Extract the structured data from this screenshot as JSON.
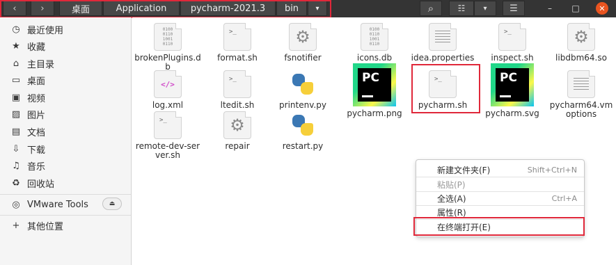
{
  "header": {
    "back_icon": "‹",
    "forward_icon": "›",
    "breadcrumbs": [
      "桌面",
      "Application",
      "pycharm-2021.3",
      "bin"
    ],
    "breadcrumb_menu_icon": "▾",
    "search_icon": "⌕",
    "view_icon": "☷",
    "view_dropdown_icon": "▾",
    "menu_icon": "☰",
    "minimize_icon": "–",
    "maximize_icon": "□",
    "close_icon": "✕"
  },
  "sidebar": {
    "items": [
      {
        "icon": "◷",
        "icon_name": "recent-icon",
        "label": "最近使用"
      },
      {
        "icon": "★",
        "icon_name": "star-icon",
        "label": "收藏"
      },
      {
        "icon": "⌂",
        "icon_name": "home-icon",
        "label": "主目录"
      },
      {
        "icon": "▭",
        "icon_name": "desktop-icon",
        "label": "桌面"
      },
      {
        "icon": "▣",
        "icon_name": "video-icon",
        "label": "视频"
      },
      {
        "icon": "▨",
        "icon_name": "picture-icon",
        "label": "图片"
      },
      {
        "icon": "▤",
        "icon_name": "document-icon",
        "label": "文档"
      },
      {
        "icon": "⇩",
        "icon_name": "download-icon",
        "label": "下载"
      },
      {
        "icon": "♫",
        "icon_name": "music-icon",
        "label": "音乐"
      },
      {
        "icon": "♻",
        "icon_name": "trash-icon",
        "label": "回收站"
      }
    ],
    "device": {
      "icon": "◎",
      "label": "VMware Tools",
      "eject_icon": "⏏"
    },
    "other": {
      "icon": "+",
      "label": "其他位置"
    }
  },
  "files": [
    {
      "name": "brokenPlugins.db",
      "type": "binary"
    },
    {
      "name": "format.sh",
      "type": "shell"
    },
    {
      "name": "fsnotifier",
      "type": "exec"
    },
    {
      "name": "icons.db",
      "type": "binary"
    },
    {
      "name": "idea.properties",
      "type": "text"
    },
    {
      "name": "inspect.sh",
      "type": "shell"
    },
    {
      "name": "libdbm64.so",
      "type": "exec"
    },
    {
      "name": "log.xml",
      "type": "xml"
    },
    {
      "name": "ltedit.sh",
      "type": "shell"
    },
    {
      "name": "printenv.py",
      "type": "python"
    },
    {
      "name": "pycharm.png",
      "type": "pycharm"
    },
    {
      "name": "pycharm.sh",
      "type": "shell"
    },
    {
      "name": "pycharm.svg",
      "type": "pycharm"
    },
    {
      "name": "pycharm64.vmoptions",
      "type": "text"
    },
    {
      "name": "remote-dev-server.sh",
      "type": "shell"
    },
    {
      "name": "repair",
      "type": "exec"
    },
    {
      "name": "restart.py",
      "type": "python"
    }
  ],
  "context_menu": {
    "items": [
      {
        "label": "新建文件夹(F)",
        "accel": "Shift+Ctrl+N",
        "enabled": true
      },
      {
        "label": "粘贴(P)",
        "accel": "",
        "enabled": false
      },
      {
        "label": "全选(A)",
        "accel": "Ctrl+A",
        "enabled": true
      },
      {
        "label": "属性(R)",
        "accel": "",
        "enabled": true
      },
      {
        "label": "在终端打开(E)",
        "accel": "",
        "enabled": true
      }
    ]
  },
  "colors": {
    "highlight_box": "#e0283a",
    "header_bg": "#343434",
    "close_button": "#e95420"
  }
}
